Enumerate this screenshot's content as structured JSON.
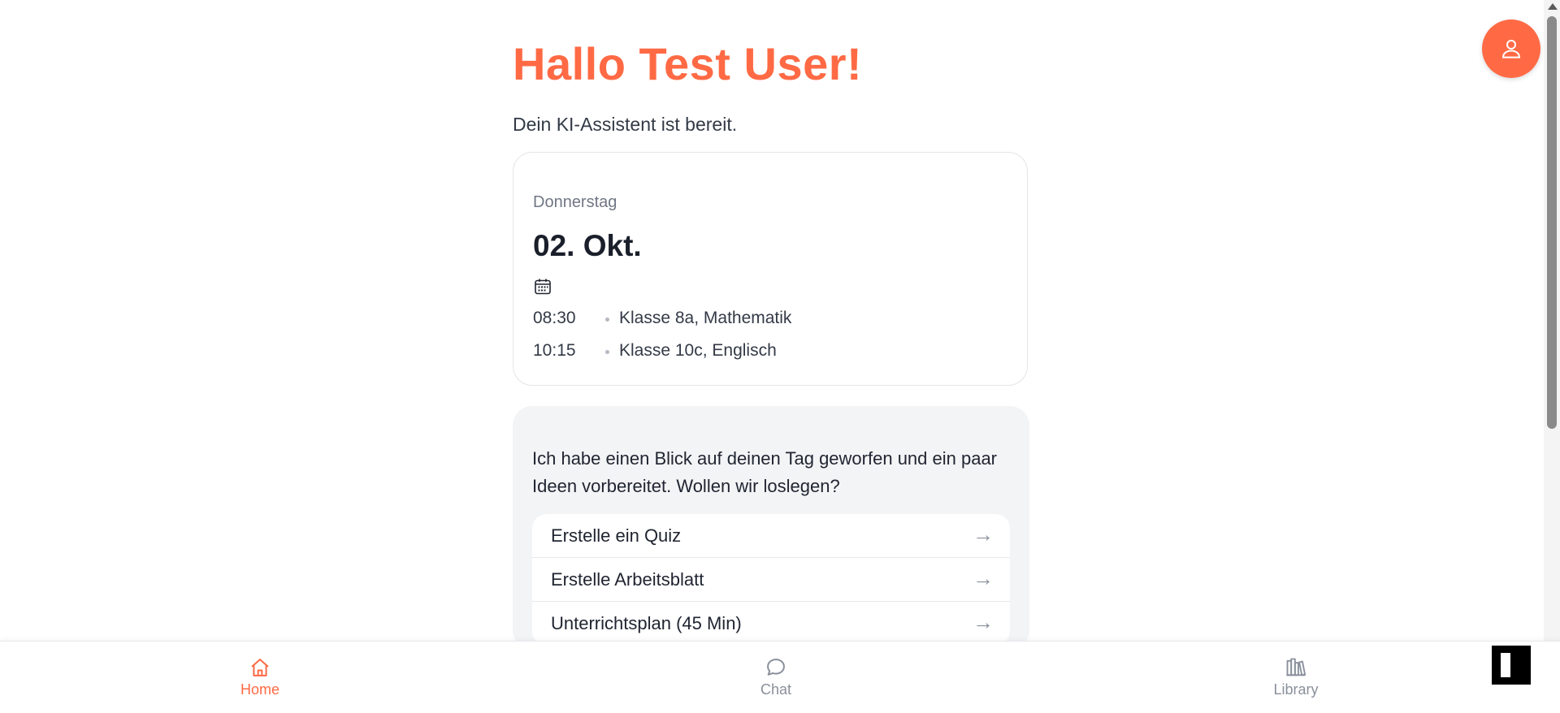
{
  "header": {
    "greeting": "Hallo Test User!",
    "subtitle": "Dein KI-Assistent ist bereit.",
    "profile_icon": "user-icon"
  },
  "day_card": {
    "weekday": "Donnerstag",
    "date": "02. Okt.",
    "calendar_icon": "calendar-icon",
    "schedule": [
      {
        "time": "08:30",
        "text": "Klasse 8a, Mathematik"
      },
      {
        "time": "10:15",
        "text": "Klasse 10c, Englisch"
      }
    ]
  },
  "assistant": {
    "message": "Ich habe einen Blick auf deinen Tag geworfen und ein paar Ideen vorbereitet. Wollen wir loslegen?",
    "actions": [
      {
        "label": "Erstelle ein Quiz",
        "arrow": "→"
      },
      {
        "label": "Erstelle Arbeitsblatt",
        "arrow": "→"
      },
      {
        "label": "Unterrichtsplan (45 Min)",
        "arrow": "→"
      }
    ]
  },
  "bottom_nav": {
    "items": [
      {
        "label": "Home",
        "icon": "home-icon",
        "active": true
      },
      {
        "label": "Chat",
        "icon": "chat-bubble-icon",
        "active": false
      },
      {
        "label": "Library",
        "icon": "library-books-icon",
        "active": false
      }
    ]
  },
  "colors": {
    "accent": "#ff6a45",
    "muted": "#8a909b",
    "card_background": "#f3f4f6"
  }
}
